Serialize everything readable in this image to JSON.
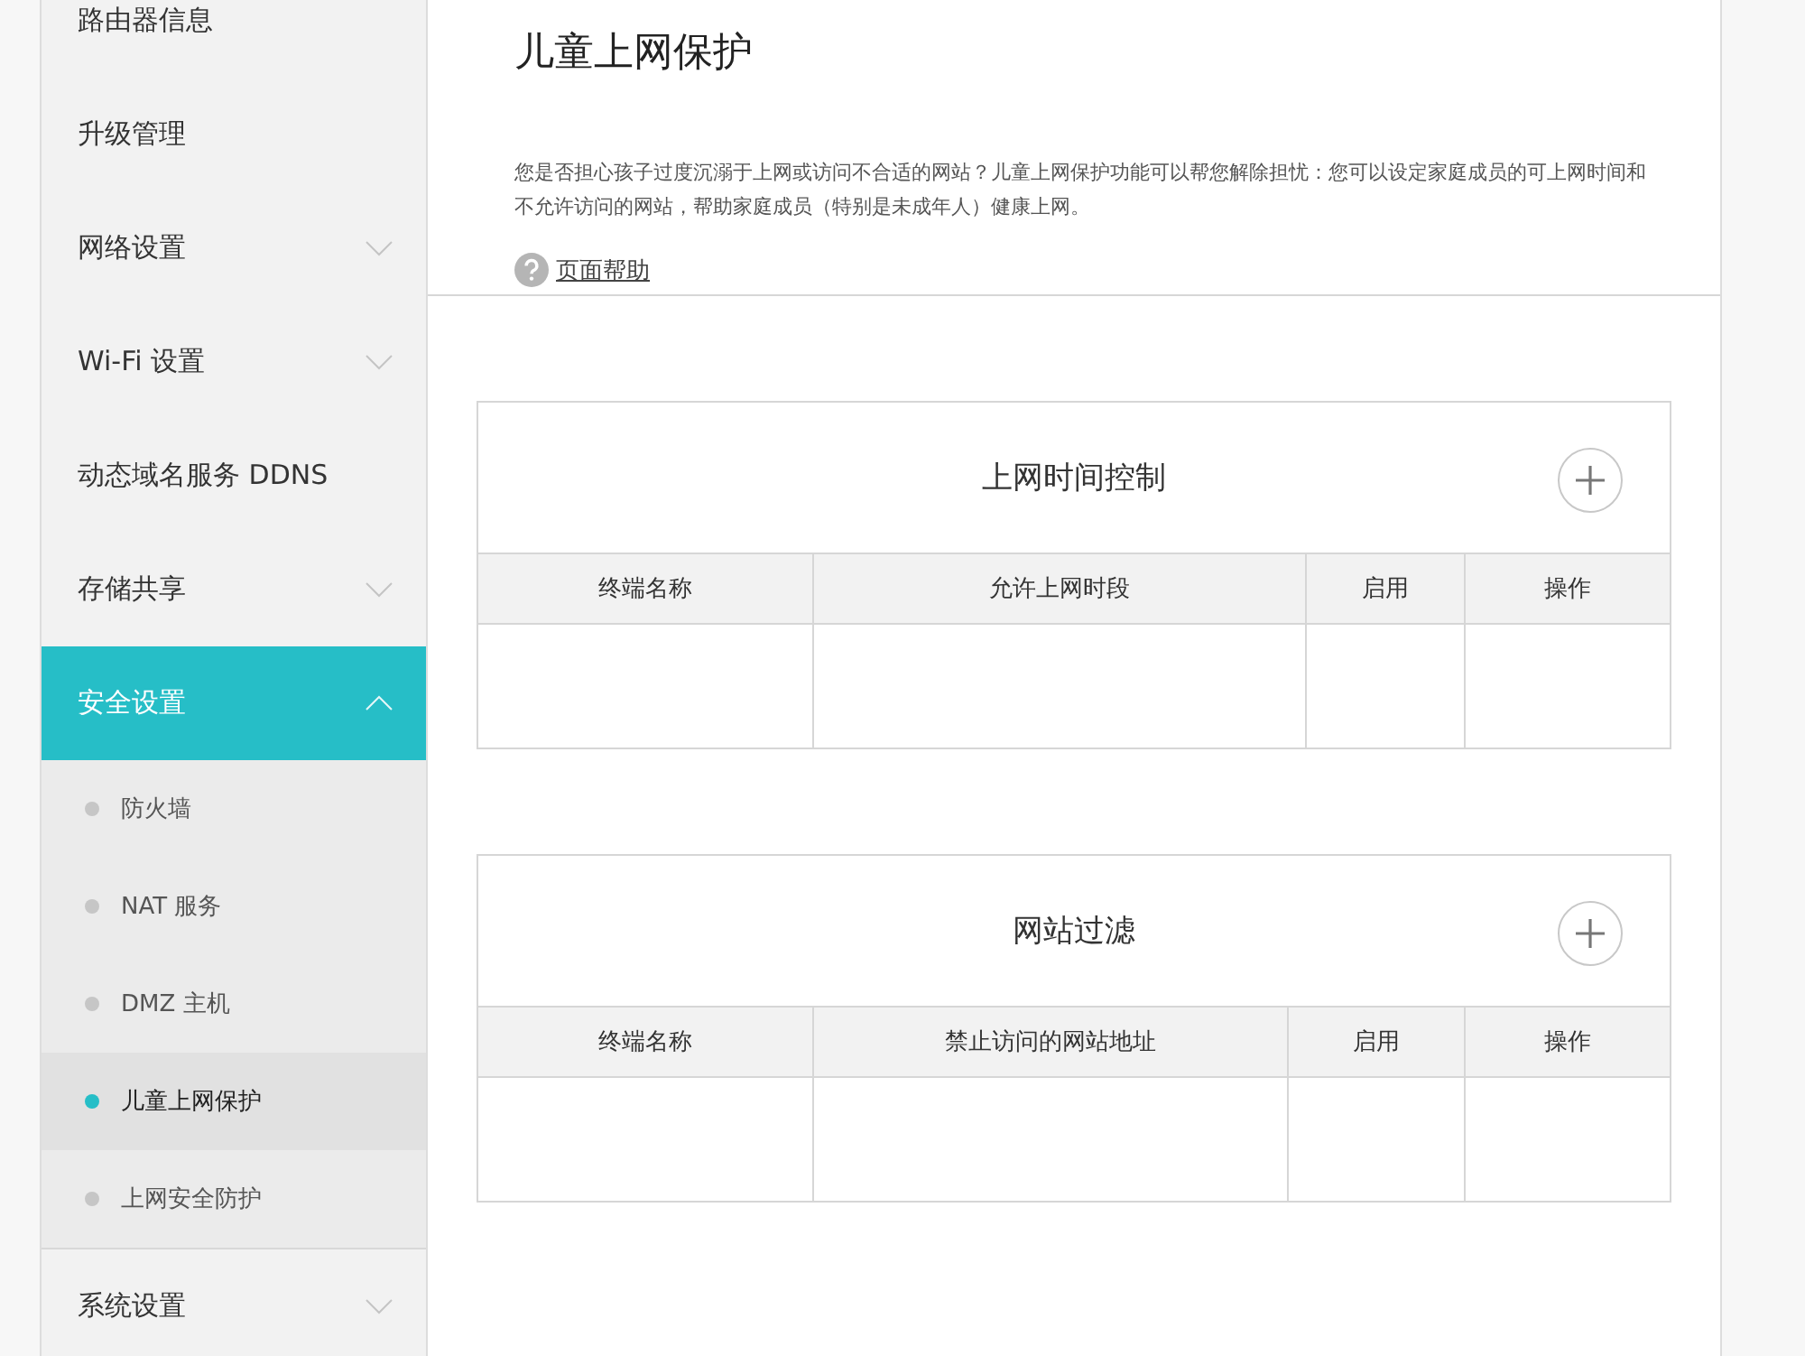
{
  "sidebar": {
    "items": [
      {
        "kind": "link",
        "label": "路由器信息",
        "selected": false
      },
      {
        "kind": "link",
        "label": "升级管理",
        "selected": false
      },
      {
        "kind": "group",
        "label": "网络设置",
        "selected": false,
        "expanded": false
      },
      {
        "kind": "group",
        "label": "Wi-Fi 设置",
        "selected": false,
        "expanded": false
      },
      {
        "kind": "link",
        "label": "动态域名服务 DDNS",
        "selected": false
      },
      {
        "kind": "group",
        "label": "存储共享",
        "selected": false,
        "expanded": false
      },
      {
        "kind": "group",
        "label": "安全设置",
        "selected": true,
        "expanded": true,
        "children": [
          {
            "label": "防火墙",
            "selected": false
          },
          {
            "label": "NAT 服务",
            "selected": false
          },
          {
            "label": "DMZ 主机",
            "selected": false
          },
          {
            "label": "儿童上网保护",
            "selected": true
          },
          {
            "label": "上网安全防护",
            "selected": false
          }
        ]
      },
      {
        "kind": "group",
        "label": "系统设置",
        "selected": false,
        "expanded": false
      }
    ]
  },
  "page": {
    "title": "儿童上网保护",
    "description": "您是否担心孩子过度沉溺于上网或访问不合适的网站？儿童上网保护功能可以帮您解除担忧：您可以设定家庭成员的可上网时间和不允许访问的网站，帮助家庭成员（特别是未成年人）健康上网。",
    "help_link": "页面帮助"
  },
  "tables": [
    {
      "title": "上网时间控制",
      "columns": [
        "终端名称",
        "允许上网时段",
        "启用",
        "操作"
      ]
    },
    {
      "title": "网站过滤",
      "columns": [
        "终端名称",
        "禁止访问的网站地址",
        "启用",
        "操作"
      ]
    }
  ]
}
